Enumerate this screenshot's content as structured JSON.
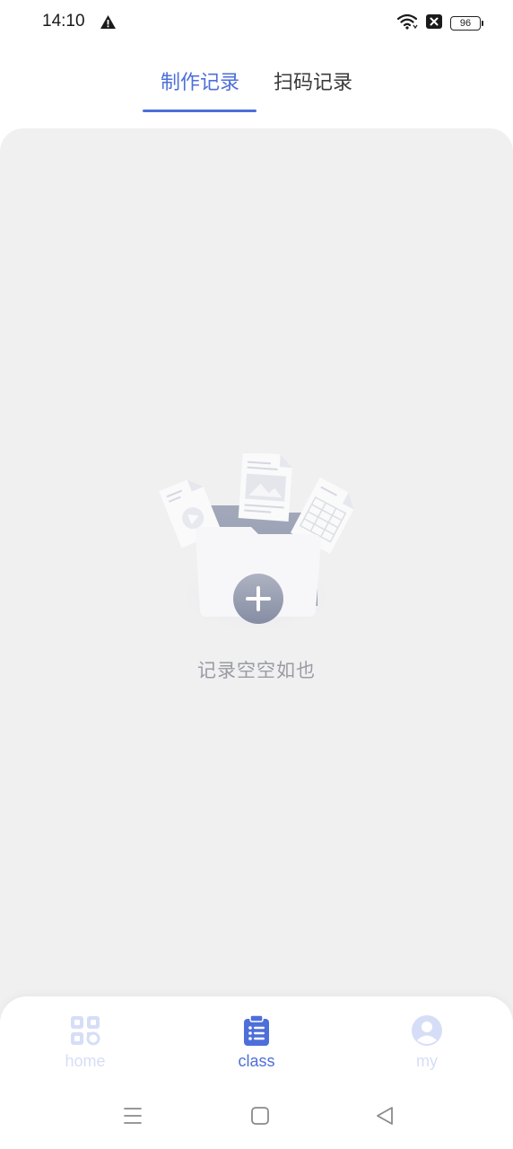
{
  "status_bar": {
    "time": "14:10",
    "battery": "96",
    "icons": [
      "warning-icon",
      "wifi-icon",
      "notification-x-icon",
      "battery-icon"
    ]
  },
  "tabs": [
    {
      "label": "制作记录",
      "active": true
    },
    {
      "label": "扫码记录",
      "active": false
    }
  ],
  "empty_state": {
    "message": "记录空空如也",
    "icon": "empty-folder-illustration"
  },
  "bottom_nav": [
    {
      "label": "home",
      "icon": "qr-grid-icon",
      "active": false
    },
    {
      "label": "class",
      "icon": "clipboard-list-icon",
      "active": true
    },
    {
      "label": "my",
      "icon": "user-avatar-icon",
      "active": false
    }
  ],
  "system_nav": [
    "menu-icon",
    "home-square-icon",
    "back-triangle-icon"
  ],
  "colors": {
    "accent": "#4d6fd9",
    "accent_inactive": "#d6def7",
    "content_bg": "#f0f0f1",
    "empty_text": "#9a9ca3"
  }
}
